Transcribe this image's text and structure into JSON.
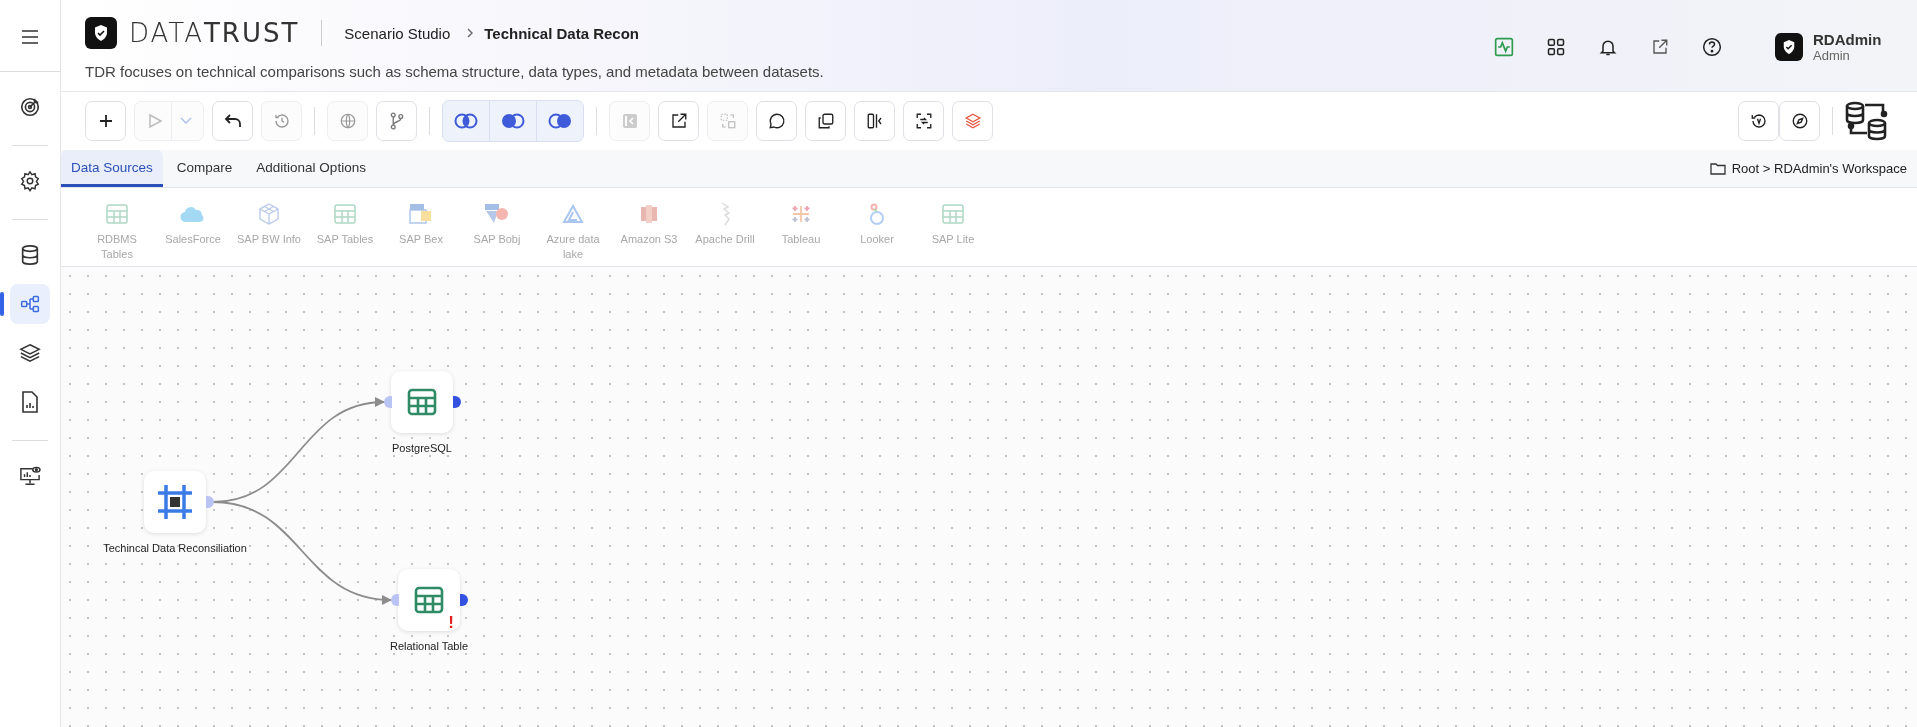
{
  "sidebar": {
    "items": [
      {
        "kind": "menu",
        "selected": false
      },
      {
        "kind": "target",
        "selected": false
      },
      {
        "kind": "gear",
        "selected": false
      },
      {
        "kind": "database",
        "selected": false
      },
      {
        "kind": "flow",
        "selected": true
      },
      {
        "kind": "layers",
        "selected": false
      },
      {
        "kind": "report",
        "selected": false
      },
      {
        "kind": "monitor",
        "selected": false
      }
    ]
  },
  "header": {
    "brand": "DATA**TRUST**",
    "breadcrumb": [
      {
        "label": "Scenario Studio",
        "current": false
      },
      {
        "label": "Technical Data Recon",
        "current": true
      }
    ],
    "description": "TDR focuses on technical comparisons such as schema structure, data types, and metadata between datasets.",
    "icons": [
      {
        "kind": "activity"
      },
      {
        "kind": "apps"
      },
      {
        "kind": "bell"
      },
      {
        "kind": "external"
      },
      {
        "kind": "help"
      }
    ],
    "user": {
      "name": "RDAdmin",
      "role": "Admin"
    }
  },
  "toolbar": {
    "groups": [
      [
        {
          "kind": "add",
          "disabled": false
        },
        {
          "kind": "run",
          "disabled": true
        },
        {
          "kind": "undo",
          "disabled": false
        },
        {
          "kind": "history",
          "disabled": true
        }
      ],
      [
        {
          "kind": "globe",
          "disabled": true
        },
        {
          "kind": "branch",
          "disabled": false
        }
      ],
      [
        {
          "kind": "inner-join"
        },
        {
          "kind": "left-join"
        },
        {
          "kind": "right-join"
        }
      ],
      [
        {
          "kind": "collapse",
          "disabled": true
        },
        {
          "kind": "export",
          "disabled": false
        },
        {
          "kind": "swap",
          "disabled": true
        },
        {
          "kind": "comment",
          "disabled": false
        },
        {
          "kind": "copy",
          "disabled": false
        },
        {
          "kind": "split",
          "disabled": false
        },
        {
          "kind": "scan",
          "disabled": false
        },
        {
          "kind": "stack",
          "disabled": false
        }
      ]
    ],
    "right": [
      {
        "kind": "version",
        "disabled": false
      },
      {
        "kind": "compass",
        "disabled": false
      }
    ]
  },
  "tabs": [
    {
      "label": "Data Sources",
      "selected": true
    },
    {
      "label": "Compare",
      "selected": false
    },
    {
      "label": "Additional Options",
      "selected": false
    }
  ],
  "workspace_path": "Root > RDAdmin's Workspace",
  "data_sources": [
    {
      "label": "RDBMS Tables",
      "kind": "table",
      "disabled": true
    },
    {
      "label": "SalesForce",
      "kind": "cloud",
      "disabled": true
    },
    {
      "label": "SAP BW Info",
      "kind": "cube",
      "disabled": true
    },
    {
      "label": "SAP Tables",
      "kind": "table",
      "disabled": true
    },
    {
      "label": "SAP Bex",
      "kind": "sap-bex",
      "disabled": true
    },
    {
      "label": "SAP Bobj",
      "kind": "sap-bobj",
      "disabled": true
    },
    {
      "label": "Azure data lake",
      "kind": "azure",
      "disabled": true
    },
    {
      "label": "Amazon S3",
      "kind": "s3",
      "disabled": true
    },
    {
      "label": "Apache Drill",
      "kind": "drill",
      "disabled": true
    },
    {
      "label": "Tableau",
      "kind": "tableau",
      "disabled": true
    },
    {
      "label": "Looker",
      "kind": "looker",
      "disabled": true
    },
    {
      "label": "SAP Lite",
      "kind": "table",
      "disabled": true
    }
  ],
  "canvas": {
    "source": {
      "label": "Techincal Data Reconsiliation",
      "kind": "reconcile",
      "targets": [
        {
          "label": "PostgreSQL",
          "kind": "table"
        },
        {
          "label": "Relational Table",
          "kind": "table",
          "warning_mark": "!"
        }
      ]
    }
  }
}
